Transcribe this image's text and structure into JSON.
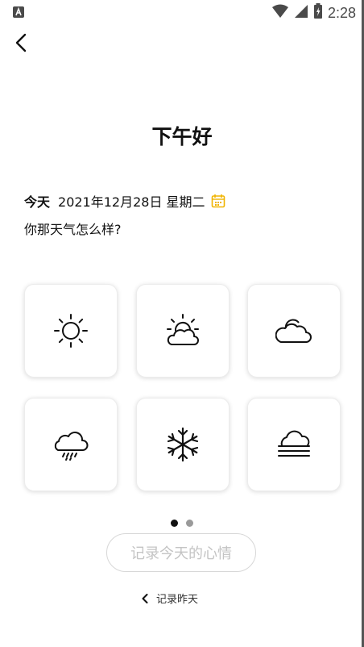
{
  "status_bar": {
    "time": "2:28",
    "icons": [
      "app-notification-icon",
      "wifi-icon",
      "signal-icon",
      "battery-charging-icon"
    ]
  },
  "header": {
    "back_icon": "chevron-left-icon"
  },
  "greeting": "下午好",
  "date": {
    "today_label": "今天",
    "date_text": "2021年12月28日 星期二",
    "calendar_icon": "calendar-icon",
    "accent_color": "#f0b400"
  },
  "question": "你那天气怎么样?",
  "weather_options": [
    {
      "icon": "sun-icon"
    },
    {
      "icon": "partly-sunny-icon"
    },
    {
      "icon": "cloudy-icon"
    },
    {
      "icon": "rain-icon"
    },
    {
      "icon": "snow-icon"
    },
    {
      "icon": "fog-icon"
    }
  ],
  "pager": {
    "total": 2,
    "current": 1
  },
  "record_button": {
    "label": "记录今天的心情"
  },
  "prev_link": {
    "label": "记录昨天",
    "icon": "chevron-left-icon"
  }
}
